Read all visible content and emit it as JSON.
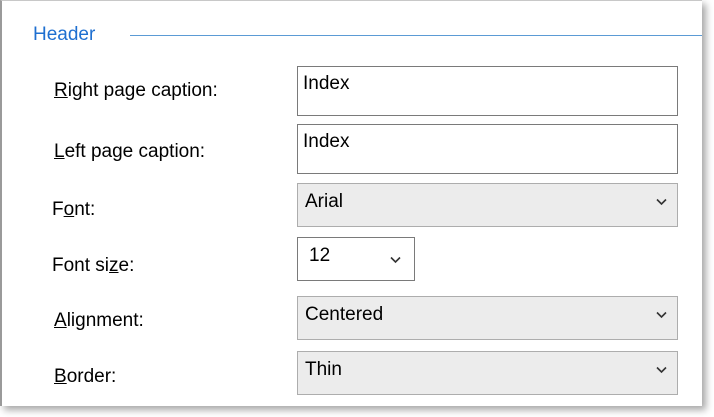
{
  "group": {
    "title": "Header"
  },
  "fields": {
    "right_caption": {
      "label_key": "R",
      "label_rest": "ight page caption:",
      "value": "Index"
    },
    "left_caption": {
      "label_key": "L",
      "label_rest": "eft page caption:",
      "value": "Index"
    },
    "font": {
      "label_pre": "F",
      "label_key": "o",
      "label_rest": "nt:",
      "value": "Arial"
    },
    "font_size": {
      "label_pre": "Font si",
      "label_key": "z",
      "label_rest": "e:",
      "value": "12"
    },
    "alignment": {
      "label_key": "A",
      "label_rest": "lignment:",
      "value": "Centered"
    },
    "border": {
      "label_key": "B",
      "label_rest": "order:",
      "value": "Thin"
    }
  },
  "colors": {
    "group_title": "#1e6fd0",
    "group_line": "#5b9bd5",
    "combo_background": "#ececec"
  },
  "icons": {
    "dropdown": "chevron-down-icon"
  }
}
